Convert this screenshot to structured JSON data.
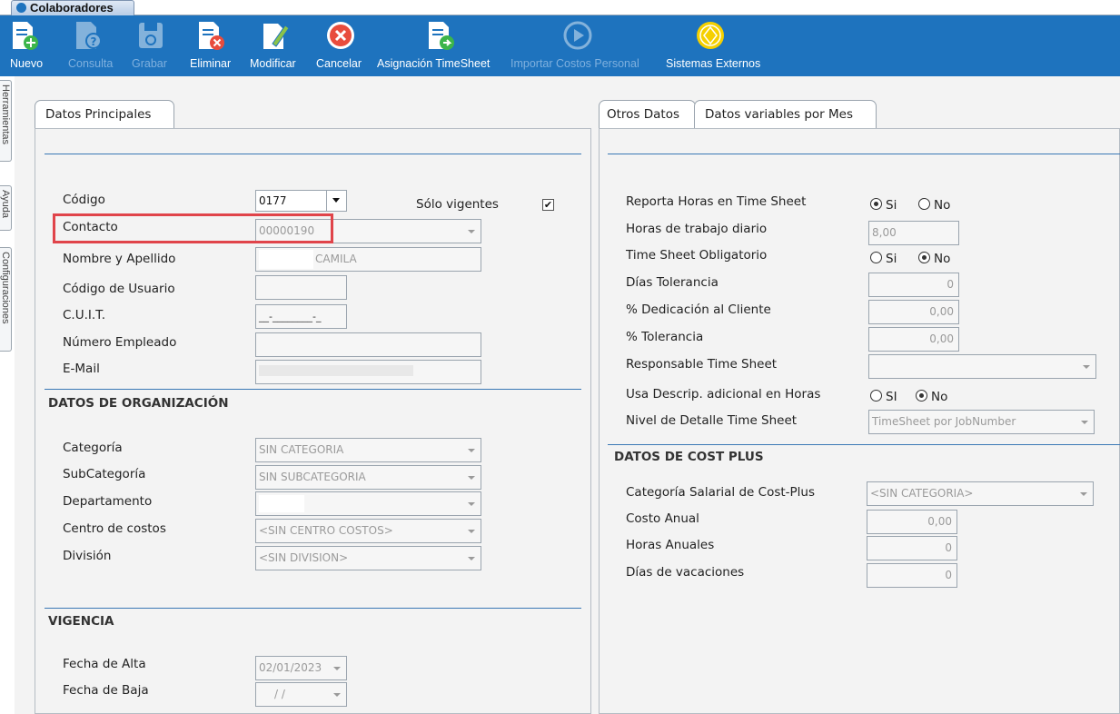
{
  "window_tab": {
    "title": "Colaboradores"
  },
  "toolbar": {
    "nuevo": "Nuevo",
    "consulta": "Consulta",
    "grabar": "Grabar",
    "eliminar": "Eliminar",
    "modificar": "Modificar",
    "cancelar": "Cancelar",
    "asignacion": "Asignación TimeSheet",
    "importar": "Importar Costos Personal",
    "sistemas": "Sistemas Externos"
  },
  "side_tabs": [
    "Herramientas",
    "Ayuda",
    "Configuraciones"
  ],
  "left_panel": {
    "tab": "Datos Principales",
    "codigo": {
      "label": "Código",
      "value": "0177"
    },
    "solo_vigentes": {
      "label": "Sólo vigentes",
      "checked": true,
      "mark": "✔"
    },
    "contacto": {
      "label": "Contacto",
      "value": "00000190"
    },
    "nombre": {
      "label": "Nombre y Apellido",
      "value": "CAMILA"
    },
    "codigo_usuario": {
      "label": "Código de Usuario",
      "value": ""
    },
    "cuit": {
      "label": "C.U.I.T.",
      "value": "__-________-_"
    },
    "numero_empleado": {
      "label": "Número Empleado",
      "value": ""
    },
    "email": {
      "label": "E-Mail",
      "value": ""
    },
    "org_section": "DATOS DE ORGANIZACIÓN",
    "categoria": {
      "label": "Categoría",
      "value": "SIN CATEGORIA"
    },
    "subcategoria": {
      "label": "SubCategoría",
      "value": "SIN SUBCATEGORIA"
    },
    "departamento": {
      "label": "Departamento",
      "value": ""
    },
    "centro_costos": {
      "label": "Centro de costos",
      "value": "<SIN CENTRO COSTOS>"
    },
    "division": {
      "label": "División",
      "value": "<SIN DIVISION>"
    },
    "vigencia_section": "VIGENCIA",
    "fecha_alta": {
      "label": "Fecha de Alta",
      "value": "02/01/2023"
    },
    "fecha_baja": {
      "label": "Fecha de Baja",
      "value": "/ /"
    }
  },
  "right_panel": {
    "tab_otros": "Otros Datos",
    "tab_variables": "Datos variables por Mes",
    "reporta_horas": {
      "label": "Reporta Horas en Time Sheet",
      "si": "Si",
      "no": "No",
      "selected": "si"
    },
    "horas_diario": {
      "label": "Horas de trabajo diario",
      "value": "8,00"
    },
    "ts_obligatorio": {
      "label": "Time Sheet Obligatorio",
      "si": "Si",
      "no": "No",
      "selected": "no"
    },
    "dias_tolerancia": {
      "label": "Días Tolerancia",
      "value": "0"
    },
    "dedicacion": {
      "label": "% Dedicación al Cliente",
      "value": "0,00"
    },
    "tolerancia": {
      "label": "% Tolerancia",
      "value": "0,00"
    },
    "responsable": {
      "label": "Responsable Time Sheet",
      "value": ""
    },
    "usa_descrip": {
      "label": "Usa Descrip. adicional en Horas",
      "si": "SI",
      "no": "No",
      "selected": "no"
    },
    "nivel_detalle": {
      "label": "Nivel de Detalle Time Sheet",
      "value": "TimeSheet por JobNumber"
    },
    "cost_section": "DATOS DE COST PLUS",
    "cat_salarial": {
      "label": "Categoría Salarial de Cost-Plus",
      "value": "<SIN CATEGORIA>"
    },
    "costo_anual": {
      "label": "Costo Anual",
      "value": "0,00"
    },
    "horas_anuales": {
      "label": "Horas Anuales",
      "value": "0"
    },
    "dias_vacaciones": {
      "label": "Días de vacaciones",
      "value": "0"
    }
  },
  "colors": {
    "toolbar_bg": "#1e73be",
    "highlight": "#e0444a",
    "section_line": "#3a78b5"
  }
}
